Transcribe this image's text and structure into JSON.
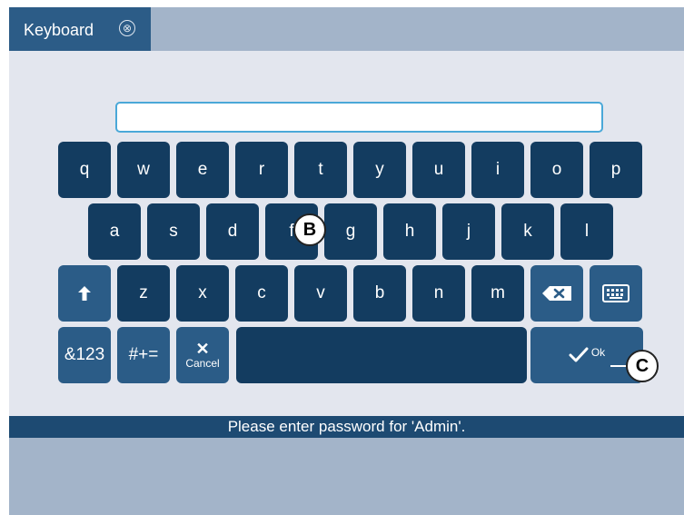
{
  "tab": {
    "title": "Keyboard",
    "close_glyph": "⊗"
  },
  "password_input": {
    "value": "",
    "placeholder": ""
  },
  "keyboard": {
    "row1": [
      "q",
      "w",
      "e",
      "r",
      "t",
      "y",
      "u",
      "i",
      "o",
      "p"
    ],
    "row2": [
      "a",
      "s",
      "d",
      "f",
      "g",
      "h",
      "j",
      "k",
      "l"
    ],
    "row3": [
      "z",
      "x",
      "c",
      "v",
      "b",
      "n",
      "m"
    ],
    "symbols_label": "&123",
    "symbols2_label": "#+=",
    "cancel_label": "Cancel",
    "cancel_glyph": "✕",
    "ok_label": "Ok",
    "shift_icon": "arrow-up-icon",
    "backspace_icon": "backspace-icon",
    "hide_keyboard_icon": "keyboard-icon"
  },
  "callouts": {
    "b": "B",
    "c": "C"
  },
  "status_message": "Please enter password for 'Admin'.",
  "colors": {
    "key": "#133c60",
    "modifier_key": "#2b5c87",
    "tab_active": "#2c5c87",
    "tabbar": "#a3b4c9",
    "body": "#e3e6ee",
    "status_bar": "#1d4a72",
    "input_border": "#4aa8d8"
  }
}
